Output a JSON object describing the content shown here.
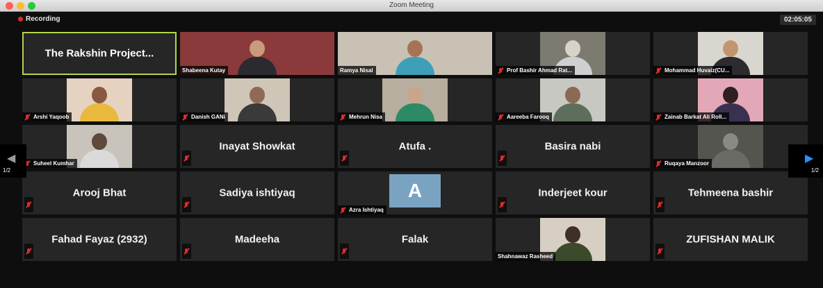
{
  "window": {
    "title": "Zoom Meeting"
  },
  "recording": {
    "label": "Recording"
  },
  "timer": "02:05:05",
  "pager": {
    "left": "1/2",
    "right": "1/2",
    "left_icon": "triangle-left-icon",
    "right_icon": "triangle-right-icon"
  },
  "tiles": [
    {
      "name": "The Rakshin Project...",
      "kind": "name",
      "active": true
    },
    {
      "name": "Shabeena Kutay",
      "kind": "video",
      "bg": "#8a3a3a",
      "head": "#c79b7c",
      "body": "#2a2a30",
      "wide": true
    },
    {
      "name": "Ramya Nisal",
      "kind": "video",
      "bg": "#c9c2b4",
      "head": "#a57458",
      "body": "#3ea0b8",
      "wide": true
    },
    {
      "name": "Prof Bashir Ahmad Rat...",
      "kind": "video",
      "bg": "#7d7a70",
      "head": "#d9d2c8",
      "body": "#cfcfcf",
      "muted": true
    },
    {
      "name": "Mohammad Huvaiz(CU...",
      "kind": "video",
      "bg": "#d9d6cf",
      "head": "#c3956f",
      "body": "#2b2b30",
      "muted": true
    },
    {
      "name": "Arshi Yaqoob",
      "kind": "video",
      "bg": "#e6d2c0",
      "head": "#8a5a40",
      "body": "#e8b93c",
      "muted": true
    },
    {
      "name": "Danish GANi",
      "kind": "video",
      "bg": "#cfc6b8",
      "head": "#8f6a56",
      "body": "#3a3a3a",
      "muted": true
    },
    {
      "name": "Mehrun Nisa",
      "kind": "video",
      "bg": "#b7aea0",
      "head": "#c9a58a",
      "body": "#2c8a64",
      "muted": true
    },
    {
      "name": "Aareeba Farooq",
      "kind": "video",
      "bg": "#c8c8c2",
      "head": "#8a6a54",
      "body": "#5e6e5c",
      "muted": true
    },
    {
      "name": "Zainab Barkat Ali Roll...",
      "kind": "video",
      "bg": "#e2a8b8",
      "head": "#2e2020",
      "body": "#3a3050",
      "muted": true
    },
    {
      "name": "Suheel Kumhar",
      "kind": "video",
      "bg": "#c8c4bc",
      "head": "#5e4a3a",
      "body": "#dadada",
      "muted": true
    },
    {
      "name": "Inayat Showkat",
      "kind": "name",
      "muted": true
    },
    {
      "name": "Atufa .",
      "kind": "name",
      "muted": true
    },
    {
      "name": "Basira nabi",
      "kind": "name",
      "muted": true
    },
    {
      "name": "Ruqaya Manzoor",
      "kind": "video",
      "bg": "#55554f",
      "head": "#8a8a84",
      "body": "#6a6a66",
      "muted": true
    },
    {
      "name": "Arooj Bhat",
      "kind": "name",
      "muted": true
    },
    {
      "name": "Sadiya ishtiyaq",
      "kind": "name",
      "muted": true
    },
    {
      "name": "Azra Ishtiyaq",
      "kind": "avatar",
      "letter": "A",
      "muted": true
    },
    {
      "name": "Inderjeet kour",
      "kind": "name",
      "muted": true
    },
    {
      "name": "Tehmeena bashir",
      "kind": "name",
      "muted": true
    },
    {
      "name": "Fahad Fayaz (2932)",
      "kind": "name",
      "muted": true
    },
    {
      "name": "Madeeha",
      "kind": "name",
      "muted": true
    },
    {
      "name": "Falak",
      "kind": "name",
      "muted": true
    },
    {
      "name": "Shahnawaz Rasheed",
      "kind": "video",
      "bg": "#d8cfc4",
      "head": "#3e3026",
      "body": "#3a4a2a"
    },
    {
      "name": "ZUFISHAN MALIK",
      "kind": "name",
      "muted": true
    }
  ]
}
